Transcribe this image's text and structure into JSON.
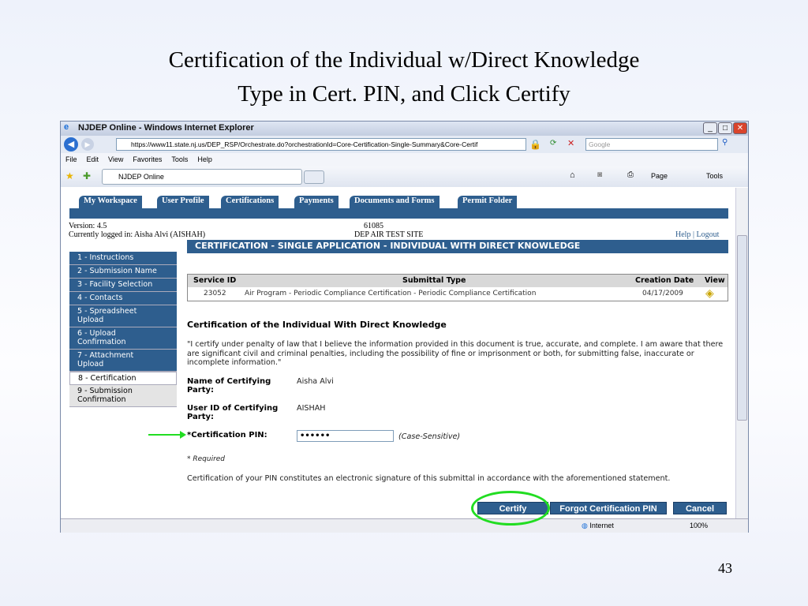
{
  "slide": {
    "title_line1": "Certification of the Individual w/Direct Knowledge",
    "title_line2": "Type in Cert. PIN, and Click Certify",
    "page_number": "43"
  },
  "browser": {
    "window_title": "NJDEP Online - Windows Internet Explorer",
    "url": "https://www11.state.nj.us/DEP_RSP/Orchestrate.do?orchestrationId=Core-Certification-Single-Summary&Core-Certif",
    "search_placeholder": "Google",
    "menu": [
      "File",
      "Edit",
      "View",
      "Favorites",
      "Tools",
      "Help"
    ],
    "tab_label": "NJDEP Online",
    "toolbar": {
      "page": "Page",
      "tools": "Tools"
    },
    "status_zone": "Internet",
    "zoom": "100%"
  },
  "app": {
    "tabs": [
      "My Workspace",
      "User Profile",
      "Certifications",
      "Payments",
      "Documents and Forms",
      "Permit Folder"
    ],
    "version": "Version: 4.5",
    "logged_in": "Currently logged in: Aisha Alvi (AISHAH)",
    "site_id": "61085",
    "site_name": "DEP AIR TEST SITE",
    "help": "Help",
    "logout": "Logout",
    "header": "CERTIFICATION - SINGLE APPLICATION - INDIVIDUAL WITH DIRECT KNOWLEDGE",
    "steps": [
      "1 - Instructions",
      "2 - Submission Name",
      "3 - Facility Selection",
      "4 - Contacts",
      "5 - Spreadsheet Upload",
      "6 - Upload Confirmation",
      "7 - Attachment Upload",
      "8 - Certification",
      "9 - Submission Confirmation"
    ],
    "table": {
      "headers": [
        "Service ID",
        "Submittal Type",
        "Creation Date",
        "View"
      ],
      "rows": [
        [
          "23052",
          "Air Program - Periodic Compliance Certification - Periodic Compliance Certification",
          "04/17/2009"
        ]
      ]
    },
    "section_title": "Certification of the Individual With Direct Knowledge",
    "statement": "\"I certify under penalty of law that I believe the information provided in this document is true, accurate, and complete. I am aware that there are significant civil and criminal penalties, including the possibility of fine or imprisonment or both, for submitting false, inaccurate or incomplete information.\"",
    "name_label": "Name of Certifying Party:",
    "name_value": "Aisha Alvi",
    "userid_label": "User ID of Certifying Party:",
    "userid_value": "AISHAH",
    "pin_label": "*Certification PIN:",
    "pin_value": "••••••",
    "pin_hint": "(Case-Sensitive)",
    "required": "* Required",
    "pin_notice": "Certification of your PIN constitutes an electronic signature of this submittal in accordance with the aforementioned statement.",
    "buttons": {
      "certify": "Certify",
      "forgot": "Forgot Certification PIN",
      "cancel": "Cancel"
    }
  },
  "colors": {
    "brand": "#2e5e8e",
    "highlight": "#22dd22"
  }
}
